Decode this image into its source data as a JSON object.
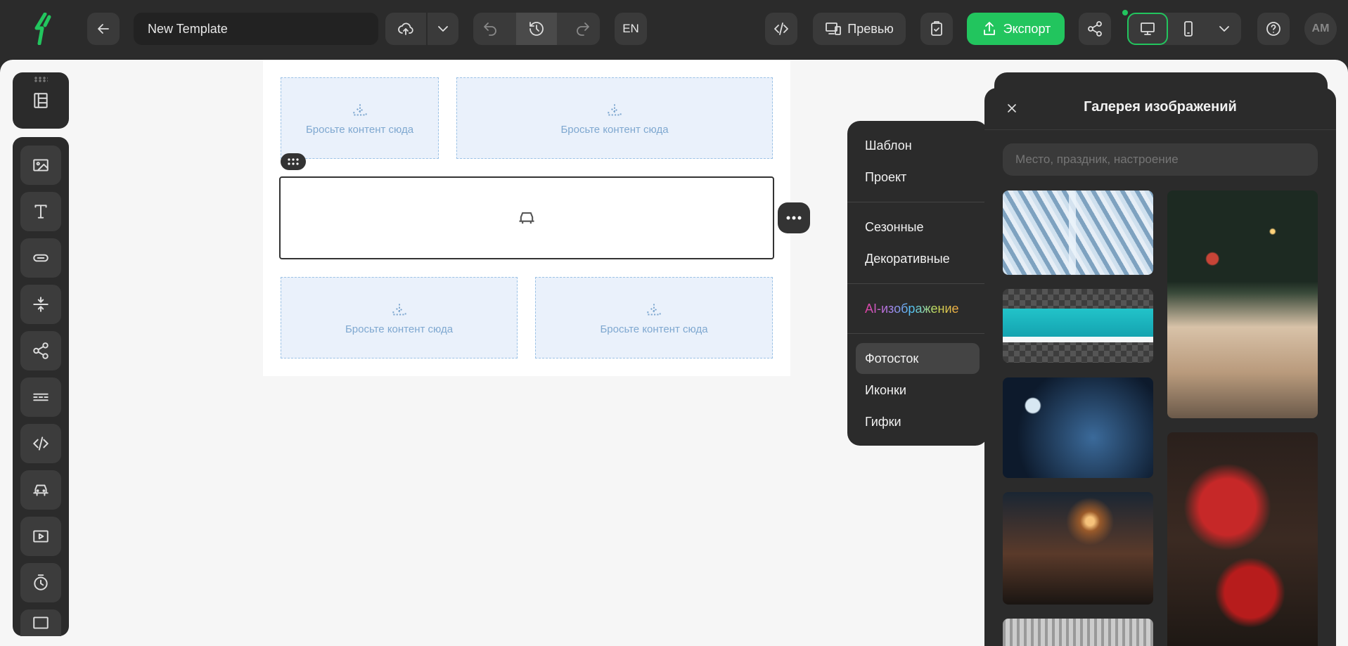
{
  "header": {
    "template_name": "New Template",
    "language": "EN",
    "preview_label": "Превью",
    "export_label": "Экспорт",
    "avatar_initials": "AM"
  },
  "canvas": {
    "drop_text": "Бросьте контент сюда"
  },
  "menu": {
    "items": [
      "Шаблон",
      "Проект",
      "Сезонные",
      "Декоративные",
      "AI-изображение",
      "Фотосток",
      "Иконки",
      "Гифки"
    ],
    "selected": "Фотосток"
  },
  "gallery": {
    "title": "Галерея изображений",
    "search_placeholder": "Место, праздник, настроение"
  },
  "colors": {
    "accent_green": "#22c55e",
    "drop_blue": "#7fa8d0",
    "dark_panel": "#2b2b2b"
  }
}
